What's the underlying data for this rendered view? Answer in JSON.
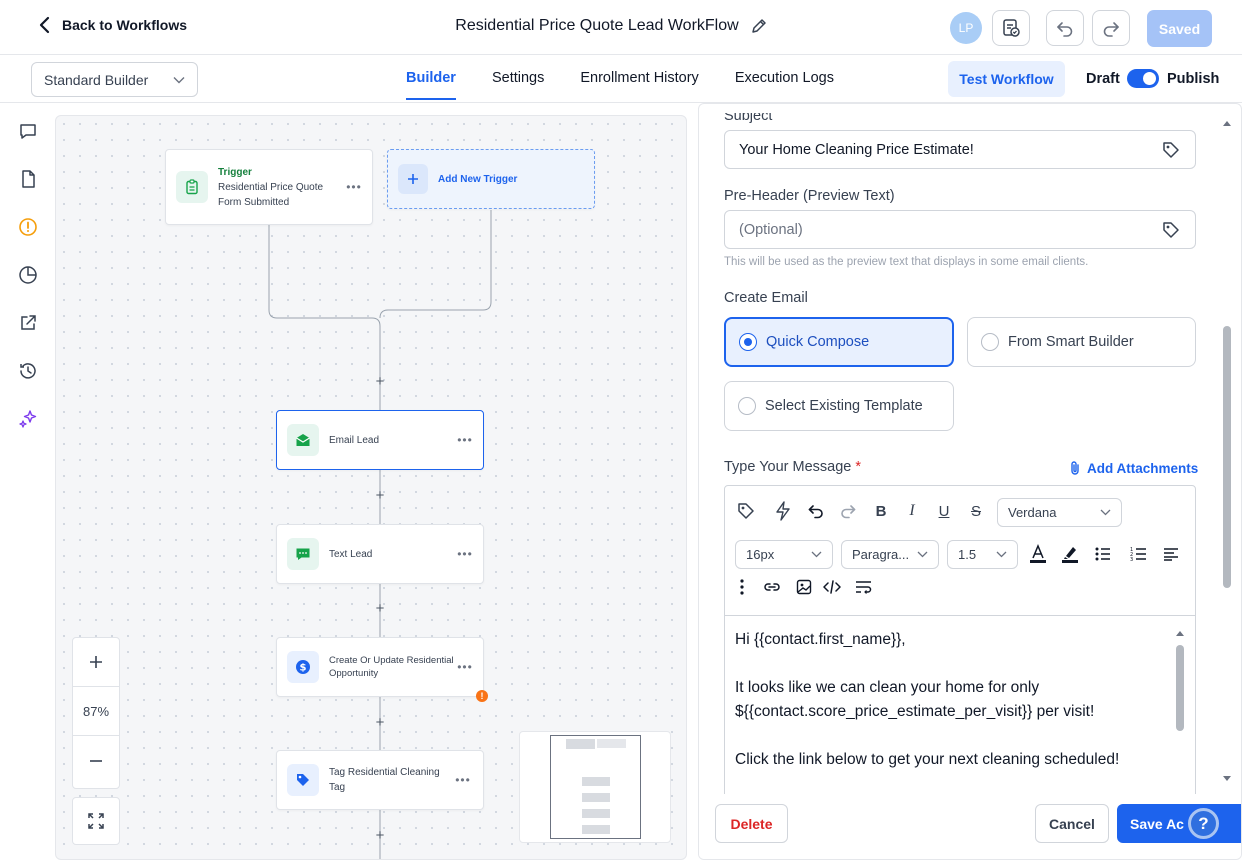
{
  "header": {
    "back_label": "Back to Workflows",
    "workflow_title": "Residential Price Quote Lead WorkFlow",
    "avatar_initials": "LP",
    "saved_label": "Saved"
  },
  "subbar": {
    "builder_mode": "Standard Builder",
    "tabs": [
      {
        "label": "Builder",
        "active": true
      },
      {
        "label": "Settings"
      },
      {
        "label": "Enrollment History"
      },
      {
        "label": "Execution Logs"
      }
    ],
    "test_label": "Test Workflow",
    "draft_label": "Draft",
    "publish_label": "Publish",
    "published": true
  },
  "rail_icons": [
    "chat-icon",
    "document-icon",
    "alert-circle-icon",
    "pie-chart-icon",
    "external-link-icon",
    "history-icon",
    "sparkle-icon"
  ],
  "canvas": {
    "trigger": {
      "kind": "Trigger",
      "name": "Residential Price Quote Form Submitted"
    },
    "add_trigger_label": "Add New Trigger",
    "actions": [
      {
        "name": "Email Lead",
        "icon": "email-icon"
      },
      {
        "name": "Text Lead",
        "icon": "sms-icon"
      },
      {
        "name": "Create Or Update Residential Opportunity",
        "icon": "dollar-icon",
        "warning": true
      },
      {
        "name": "Tag Residential Cleaning Tag",
        "icon": "tag-icon"
      }
    ],
    "zoom_level": "87%"
  },
  "panel": {
    "subject_label": "Subject",
    "subject_value": "Your Home Cleaning Price Estimate!",
    "preheader_label": "Pre-Header (Preview Text)",
    "preheader_placeholder": "(Optional)",
    "preheader_hint": "This will be used as the preview text that displays in some email clients.",
    "create_email_label": "Create Email",
    "options": {
      "quick_compose": "Quick Compose",
      "smart_builder": "From Smart Builder",
      "existing_template": "Select Existing Template"
    },
    "selected_option": "Quick Compose",
    "message_label": "Type Your Message",
    "required_mark": "*",
    "attach_label": "Add Attachments",
    "editor": {
      "font": "Verdana",
      "size": "16px",
      "block": "Paragra...",
      "line_height": "1.5",
      "lines": [
        "Hi {{contact.first_name}},",
        "It looks like we can clean your home for only ${{contact.score_price_estimate_per_visit}} per visit!",
        "Click the link below to get your next cleaning scheduled!"
      ]
    },
    "delete_label": "Delete",
    "cancel_label": "Cancel",
    "save_label": "Save Ac"
  },
  "help_label": "?",
  "colors": {
    "primary": "#1d63ed",
    "danger": "#dc2626",
    "warning": "#f97316"
  }
}
